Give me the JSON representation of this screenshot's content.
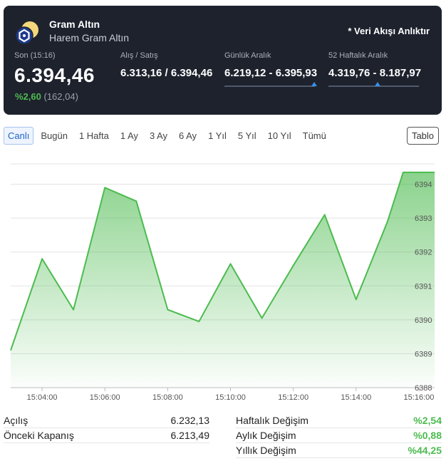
{
  "header": {
    "title": "Gram Altın",
    "subtitle": "Harem Gram Altın",
    "feed_note": "* Veri Akışı Anlıktır",
    "last_label": "Son (15:16)",
    "last_price": "6.394,46",
    "change_pct": "%2,60",
    "change_abs": "(162,04)",
    "bid_ask_label": "Alış / Satış",
    "bid_ask_value": "6.313,16 / 6.394,46",
    "daily_range_label": "Günlük Aralık",
    "daily_range_value": "6.219,12 - 6.395,93",
    "daily_range_position": 0.99,
    "week52_range_label": "52 Haftalık Aralık",
    "week52_range_value": "4.319,76 - 8.187,97",
    "week52_range_position": 0.54,
    "accent_color": "#3a8eea",
    "positive_color": "#4cbb4f"
  },
  "tabs": [
    {
      "label": "Canlı",
      "active": true
    },
    {
      "label": "Bugün",
      "active": false
    },
    {
      "label": "1 Hafta",
      "active": false
    },
    {
      "label": "1 Ay",
      "active": false
    },
    {
      "label": "3 Ay",
      "active": false
    },
    {
      "label": "6 Ay",
      "active": false
    },
    {
      "label": "1 Yıl",
      "active": false
    },
    {
      "label": "5 Yıl",
      "active": false
    },
    {
      "label": "10 Yıl",
      "active": false
    },
    {
      "label": "Tümü",
      "active": false
    }
  ],
  "tablo_label": "Tablo",
  "chart_data": {
    "type": "area",
    "x": [
      "15:03:00",
      "15:04:00",
      "15:05:00",
      "15:06:00",
      "15:07:00",
      "15:08:00",
      "15:09:00",
      "15:10:00",
      "15:11:00",
      "15:12:00",
      "15:13:00",
      "15:14:00",
      "15:15:00",
      "15:15:30",
      "15:16:00",
      "15:16:30"
    ],
    "values": [
      6389.1,
      6391.8,
      6390.3,
      6393.9,
      6393.5,
      6390.3,
      6389.95,
      6391.65,
      6390.05,
      6391.6,
      6393.1,
      6390.6,
      6392.9,
      6394.35,
      6394.35,
      6394.35
    ],
    "x_ticks": [
      "15:04:00",
      "15:06:00",
      "15:08:00",
      "15:10:00",
      "15:12:00",
      "15:14:00",
      "15:16:00"
    ],
    "y_ticks": [
      6388,
      6389,
      6390,
      6391,
      6392,
      6393,
      6394
    ],
    "ylim": [
      6388,
      6394.6
    ],
    "line_color": "#4cbb4f",
    "grid": true
  },
  "footer": {
    "left": [
      {
        "label": "Açılış",
        "value": "6.232,13"
      },
      {
        "label": "Önceki Kapanış",
        "value": "6.213,49"
      }
    ],
    "right": [
      {
        "label": "Haftalık Değişim",
        "value": "%2,54"
      },
      {
        "label": "Aylık Değişim",
        "value": "%0,88"
      },
      {
        "label": "Yıllık Değişim",
        "value": "%44,25"
      }
    ]
  }
}
